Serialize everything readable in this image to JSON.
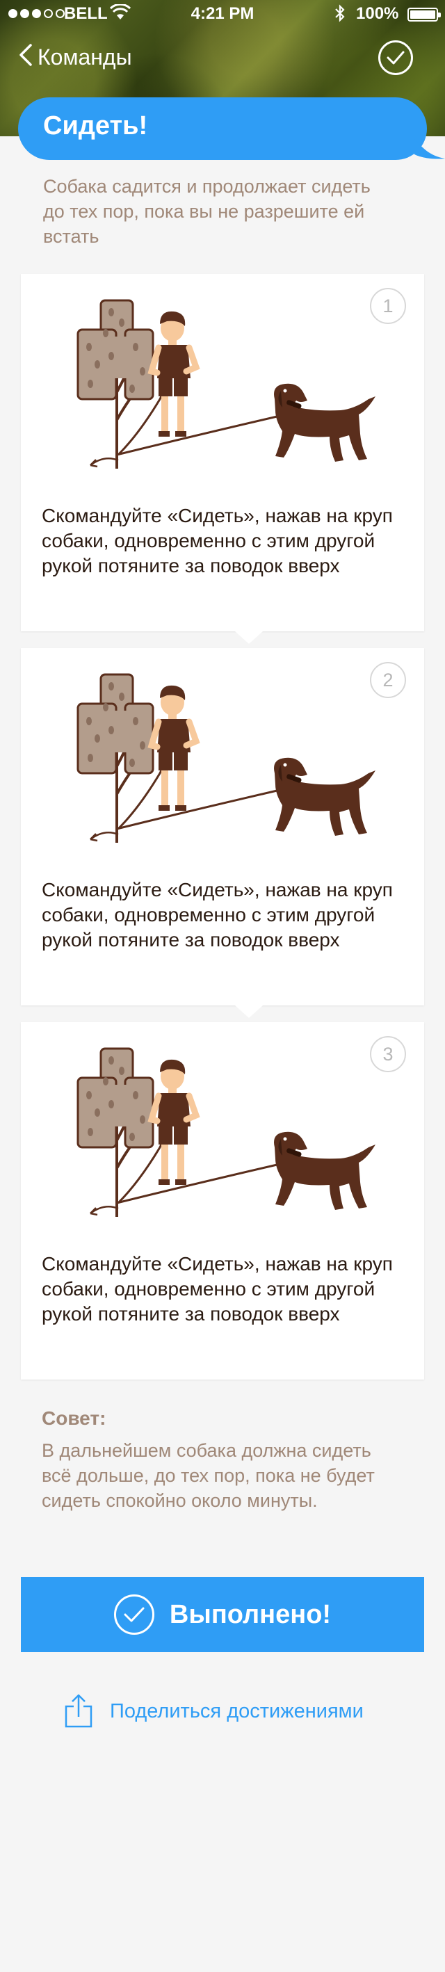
{
  "status_bar": {
    "carrier": "BELL",
    "time": "4:21 PM",
    "battery": "100%",
    "battery_level": 1.0,
    "signal_bars_filled": 3,
    "signal_bars_total": 5
  },
  "nav": {
    "back_label": "Команды"
  },
  "command": {
    "title": "Сидеть!",
    "description": "Собака садится и продолжает сидеть до тех пор, пока вы не разрешите ей встать"
  },
  "steps": [
    {
      "number": "1",
      "text": "Скомандуйте «Сидеть», нажав на круп собаки, одновременно с этим другой рукой потяните за поводок вверх"
    },
    {
      "number": "2",
      "text": "Скомандуйте «Сидеть», нажав на круп собаки, одновременно с этим другой рукой потяните за поводок вверх"
    },
    {
      "number": "3",
      "text": "Скомандуйте «Сидеть», нажав на круп собаки, одновременно с этим другой рукой потяните за поводок вверх"
    }
  ],
  "tip": {
    "title": "Совет:",
    "text": "В дальнейшем собака должна сидеть всё дольше, до тех пор, пока не будет сидеть спокойно около минуты."
  },
  "done_button": {
    "label": "Выполнено!"
  },
  "share": {
    "label": "Поделиться достижениями"
  },
  "colors": {
    "accent": "#2f9df5",
    "muted_text": "#a08878",
    "body_text": "#2b1b12",
    "dog": "#5a2e1c",
    "tree": "#b39d8c"
  },
  "icons": {
    "nav_back": "chevron-left-icon",
    "nav_done": "checkmark-circle-icon",
    "done": "checkmark-circle-icon",
    "share": "share-upload-icon"
  }
}
